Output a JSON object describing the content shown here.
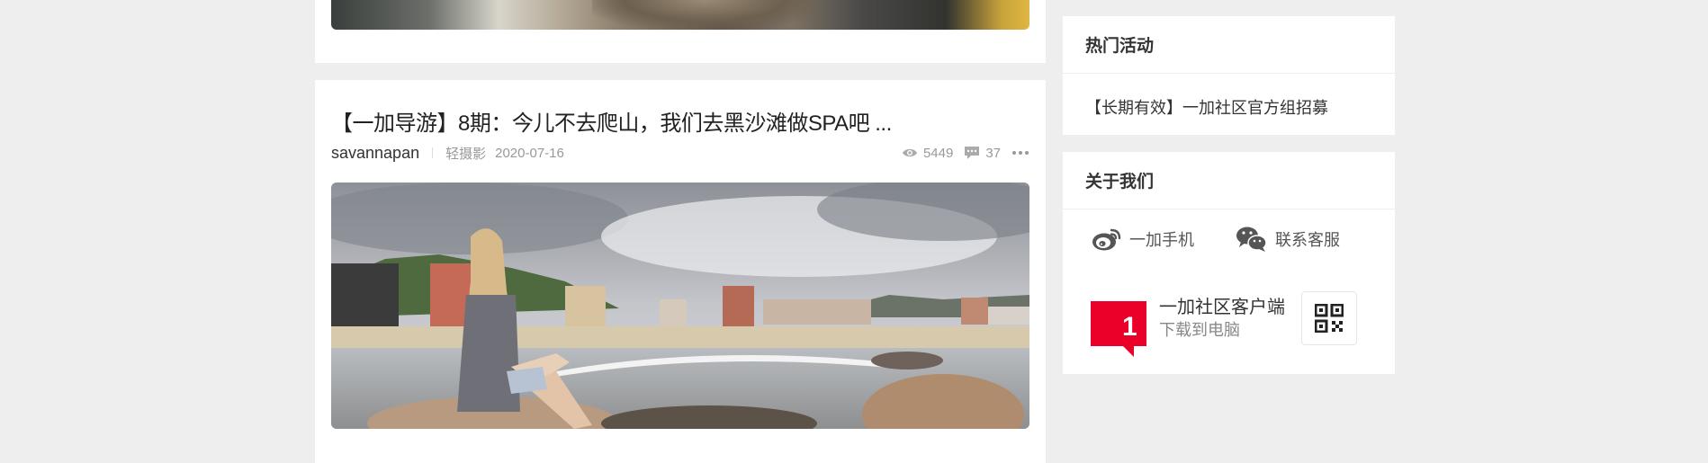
{
  "post": {
    "title": "【一加导游】8期：今儿不去爬山，我们去黑沙滩做SPA吧 ...",
    "author": "savannapan",
    "category": "轻摄影",
    "date": "2020-07-16",
    "views": "5449",
    "comments": "37"
  },
  "sidebar": {
    "hot": {
      "heading": "热门活动",
      "items": [
        {
          "label": "【长期有效】一加社区官方组招募"
        }
      ]
    },
    "about": {
      "heading": "关于我们",
      "links": [
        {
          "label": "一加手机",
          "icon": "weibo-icon"
        },
        {
          "label": "联系客服",
          "icon": "wechat-icon"
        }
      ],
      "client": {
        "logo_text": "1",
        "title": "一加社区客户端",
        "subtitle": "下载到电脑"
      }
    }
  },
  "colors": {
    "background": "#eeeeee",
    "card": "#ffffff",
    "logo_red": "#eb0029",
    "muted": "#999999"
  }
}
